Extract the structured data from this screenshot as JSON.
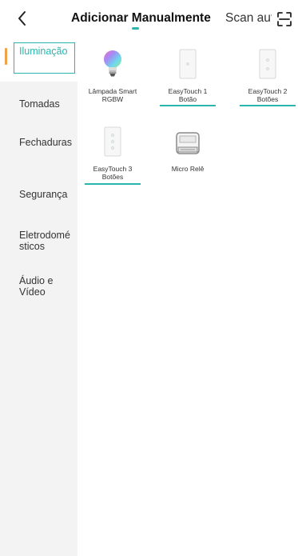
{
  "header": {
    "back_icon": "chevron-left-icon",
    "tab_manual": "Adicionar Manualmente",
    "tab_scan": "Scan automático",
    "scan_icon": "scan-frame-icon",
    "accent": "#2bb5ad"
  },
  "sidebar": {
    "items": [
      {
        "label": "Iluminação"
      },
      {
        "label": "Tomadas"
      },
      {
        "label": "Fechaduras"
      },
      {
        "label": "Segurança"
      },
      {
        "label": "Eletrodomésticos"
      },
      {
        "label": "Áudio e Vídeo"
      }
    ],
    "active_index": 0,
    "active_marker_color": "#f1a04a"
  },
  "devices": [
    {
      "name": "Lâmpada Smart RGBW",
      "icon": "rgbw-bulb-icon"
    },
    {
      "name": "EasyTouch 1 Botão",
      "icon": "switch-1-button-icon"
    },
    {
      "name": "EasyTouch 2 Botões",
      "icon": "switch-2-buttons-icon"
    },
    {
      "name": "EasyTouch 3 Botões",
      "icon": "switch-3-buttons-icon"
    },
    {
      "name": "Micro Relê",
      "icon": "micro-relay-icon"
    }
  ]
}
